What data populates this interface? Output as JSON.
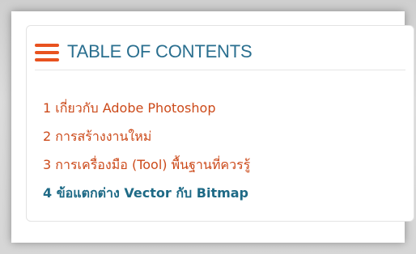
{
  "toc": {
    "title": "TABLE OF CONTENTS",
    "icon": "hamburger-menu-icon",
    "accent_color": "#e8521f",
    "title_color": "#2a6f8f",
    "items": [
      {
        "label": "1 เกี่ยวกับ Adobe Photoshop",
        "active": false
      },
      {
        "label": "2 การสร้างงานใหม่",
        "active": false
      },
      {
        "label": "3 การเครื่องมือ (Tool) พื้นฐานที่ควรรู้",
        "active": false
      },
      {
        "label": "4 ข้อแตกต่าง Vector กับ Bitmap",
        "active": true
      }
    ]
  }
}
